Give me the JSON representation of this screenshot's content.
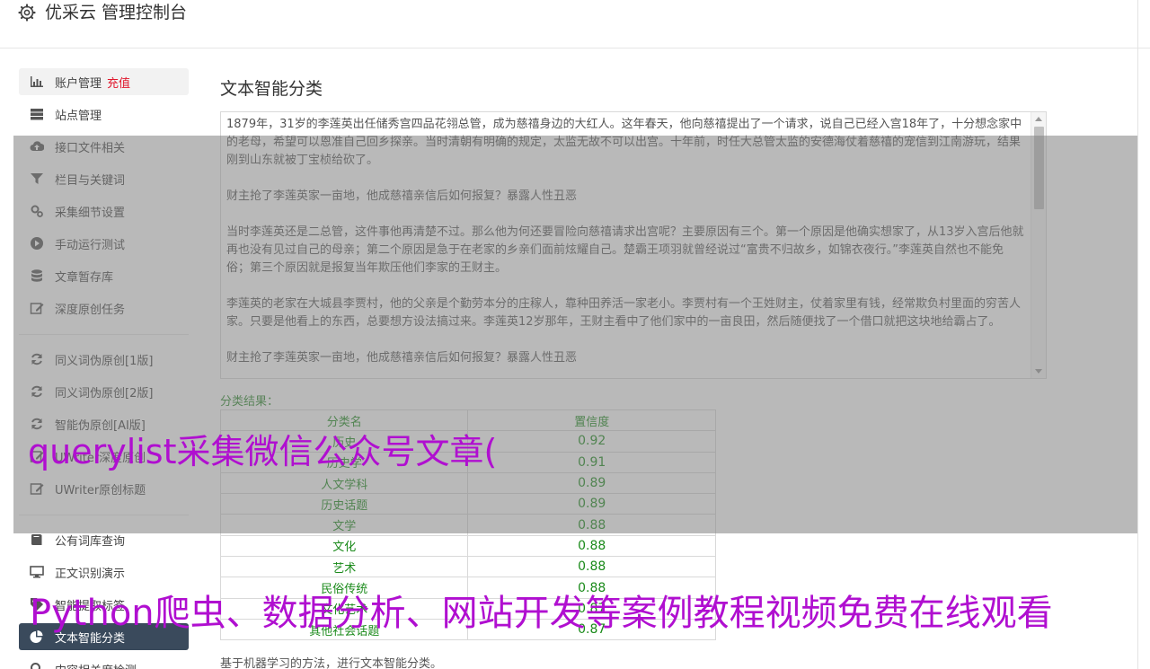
{
  "app": {
    "title": "优采云 管理控制台",
    "icon": "gear-icon"
  },
  "sidebar": {
    "items": [
      {
        "label": "账户管理",
        "badge": "充值",
        "icon": "bar-chart-icon"
      },
      {
        "label": "站点管理",
        "icon": "server-icon"
      },
      {
        "label": "接口文件相关",
        "icon": "cloud-upload-icon"
      },
      {
        "label": "栏目与关键词",
        "icon": "filter-icon"
      },
      {
        "label": "采集细节设置",
        "icon": "cogs-icon"
      },
      {
        "label": "手动运行测试",
        "icon": "play-circle-icon"
      },
      {
        "label": "文章暂存库",
        "icon": "database-icon"
      },
      {
        "label": "深度原创任务",
        "icon": "edit-icon"
      },
      {
        "label": "同义词伪原创[1版]",
        "icon": "refresh-icon"
      },
      {
        "label": "同义词伪原创[2版]",
        "icon": "refresh-icon"
      },
      {
        "label": "智能伪原创[AI版]",
        "icon": "refresh-icon"
      },
      {
        "label": "UWriter深度原创",
        "icon": "edit-icon"
      },
      {
        "label": "UWriter原创标题",
        "icon": "edit-icon"
      },
      {
        "label": "公有词库查询",
        "icon": "book-icon"
      },
      {
        "label": "正文识别演示",
        "icon": "desktop-icon"
      },
      {
        "label": "智能提取标签",
        "icon": "tag-icon"
      },
      {
        "label": "文本智能分类",
        "icon": "pie-chart-icon"
      },
      {
        "label": "内容相关度检测",
        "icon": "search-icon"
      }
    ],
    "active_index": 16,
    "active_color": "#3a4a5c",
    "badge_color": "#e0182d"
  },
  "main": {
    "title": "文本智能分类",
    "article": [
      "1879年，31岁的李莲英出任储秀宫四品花翎总管，成为慈禧身边的大红人。这年春天，他向慈禧提出了一个请求，说自己已经入宫18年了，十分想念家中的老母，希望可以恩准自己回乡探亲。当时清朝有明确的规定，太监无故不可以出宫。十年前，时任大总管太监的安德海仗着慈禧的宠信到江南游玩，结果刚到山东就被丁宝桢给砍了。",
      "财主抢了李莲英家一亩地，他成慈禧亲信后如何报复？暴露人性丑恶",
      "当时李莲英还是二总管，这件事他再清楚不过。那么他为何还要冒险向慈禧请求出宫呢？主要原因有三个。第一个原因是他确实想家了，从13岁入宫后他就再也没有见过自己的母亲；第二个原因是急于在老家的乡亲们面前炫耀自己。楚霸王项羽就曾经说过“富贵不归故乡，如锦衣夜行。”李莲英自然也不能免俗；第三个原因就是报复当年欺压他们李家的王财主。",
      "李莲英的老家在大城县李贾村，他的父亲是个勤劳本分的庄稼人，靠种田养活一家老小。李贾村有一个王姓财主，仗着家里有钱，经常欺负村里面的穷苦人家。只要是他看上的东西，总要想方设法搞过来。李莲英12岁那年，王财主看中了他们家中的一亩良田，然后随便找了一个借口就把这块地给霸占了。",
      "财主抢了李莲英家一亩地，他成慈禧亲信后如何报复？暴露人性丑恶"
    ],
    "result_label": "分类结果：",
    "table": {
      "headers": [
        "分类名",
        "置信度"
      ],
      "rows": [
        [
          "历史",
          "0.92"
        ],
        [
          "历史学",
          "0.91"
        ],
        [
          "人文学科",
          "0.89"
        ],
        [
          "历史话题",
          "0.89"
        ],
        [
          "文学",
          "0.88"
        ],
        [
          "文化",
          "0.88"
        ],
        [
          "艺术",
          "0.88"
        ],
        [
          "民俗传统",
          "0.88"
        ],
        [
          "文化艺术",
          "0.87"
        ],
        [
          "其他社会话题",
          "0.87"
        ]
      ],
      "text_color": "#1a8a1a"
    },
    "footnote": "基于机器学习的方法，进行文本智能分类。"
  },
  "watermark": {
    "line1": "querylist采集微信公众号文章(",
    "line2": "Python爬虫、数据分析、网站开发等案例教程视频免费在线观看",
    "color": "#b00fd0"
  }
}
